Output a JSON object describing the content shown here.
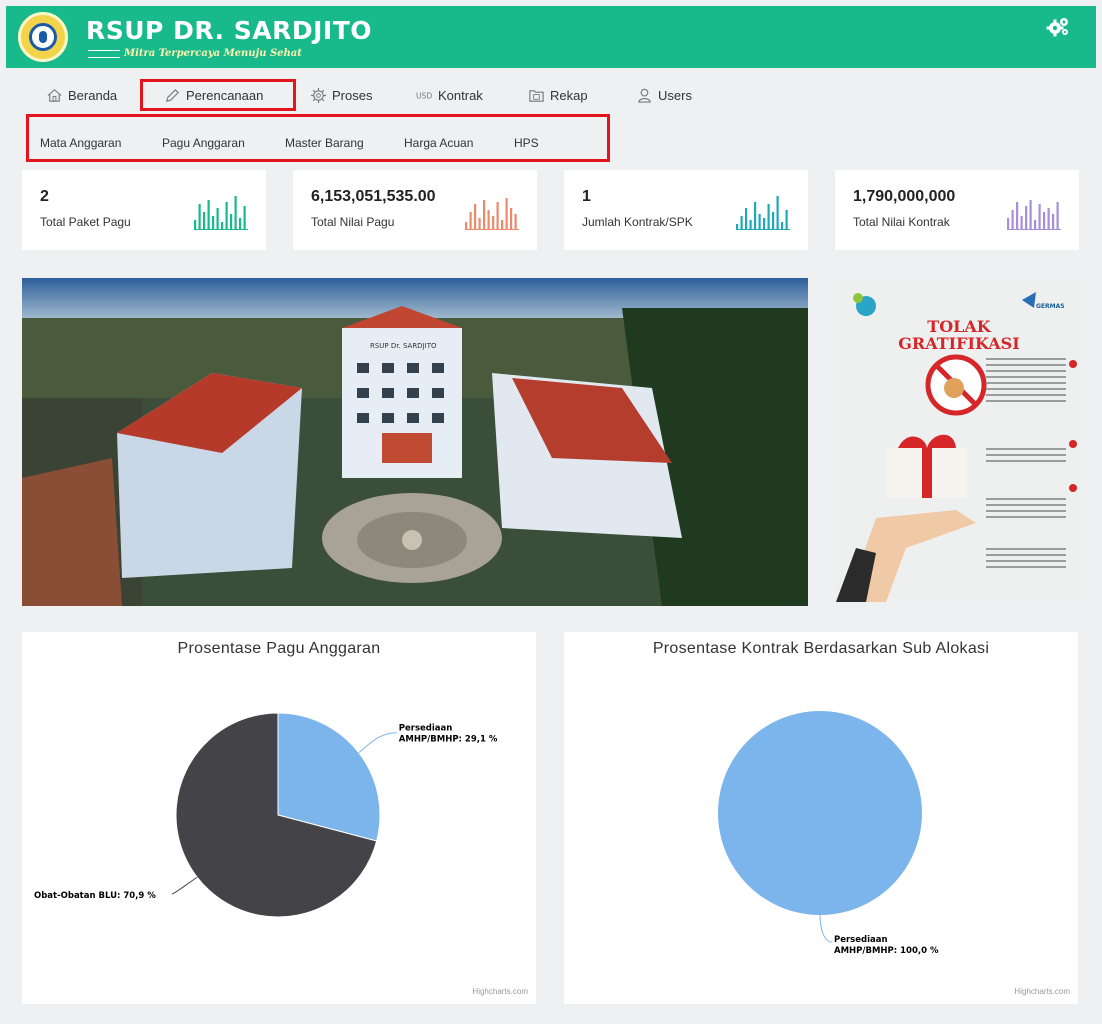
{
  "header": {
    "brand": "RSUP DR. SARDJITO",
    "tagline": "Mitra Terpercaya Menuju Sehat",
    "settings_icon": "gears-icon"
  },
  "menu": {
    "items": [
      {
        "label": "Beranda",
        "icon": "home-icon"
      },
      {
        "label": "Perencanaan",
        "icon": "pencil-icon",
        "highlighted": true
      },
      {
        "label": "Proses",
        "icon": "gear-icon"
      },
      {
        "label": "Kontrak",
        "icon": "usd-icon"
      },
      {
        "label": "Rekap",
        "icon": "folder-icon"
      },
      {
        "label": "Users",
        "icon": "user-icon"
      }
    ],
    "submenu": [
      "Mata Anggaran",
      "Pagu Anggaran",
      "Master Barang",
      "Harga Acuan",
      "HPS"
    ]
  },
  "stats": [
    {
      "value": "2",
      "label": "Total Paket Pagu",
      "color": "#18b98a"
    },
    {
      "value": "6,153,051,535.00",
      "label": "Total Nilai Pagu",
      "color": "#ee8a6c"
    },
    {
      "value": "1",
      "label": "Jumlah Kontrak/SPK",
      "color": "#1fa8b8"
    },
    {
      "value": "1,790,000,000",
      "label": "Total Nilai Kontrak",
      "color": "#a58fd8"
    }
  ],
  "banner": {
    "building_sign": "RSUP Dr. SARDJITO"
  },
  "poster": {
    "title_line1": "TOLAK",
    "title_line2": "GRATIFIKASI",
    "germas": "GERMAS"
  },
  "colors": {
    "header": "#18b98a",
    "highlight_box": "#e3141b",
    "pie_light": "#7cb5ec",
    "pie_dark": "#434348"
  },
  "charts": {
    "credit": "Highcharts.com"
  },
  "chart_data": [
    {
      "type": "pie",
      "title": "Prosentase Pagu Anggaran",
      "slices": [
        {
          "name": "Persediaan AMHP/BMHP",
          "value": 29.1,
          "label": "Persediaan AMHP/BMHP: 29,1 %",
          "label_lines": [
            "Persediaan",
            "AMHP/BMHP: 29,1 %"
          ],
          "color": "#7cb5ec"
        },
        {
          "name": "Obat-Obatan BLU",
          "value": 70.9,
          "label": "Obat-Obatan BLU: 70,9 %",
          "label_lines": [
            "Obat-Obatan BLU: 70,9 %"
          ],
          "color": "#434348"
        }
      ]
    },
    {
      "type": "pie",
      "title": "Prosentase Kontrak Berdasarkan Sub Alokasi",
      "slices": [
        {
          "name": "Persediaan AMHP/BMHP",
          "value": 100.0,
          "label": "Persediaan AMHP/BMHP: 100,0 %",
          "label_lines": [
            "Persediaan",
            "AMHP/BMHP: 100,0 %"
          ],
          "color": "#7cb5ec"
        }
      ]
    }
  ]
}
